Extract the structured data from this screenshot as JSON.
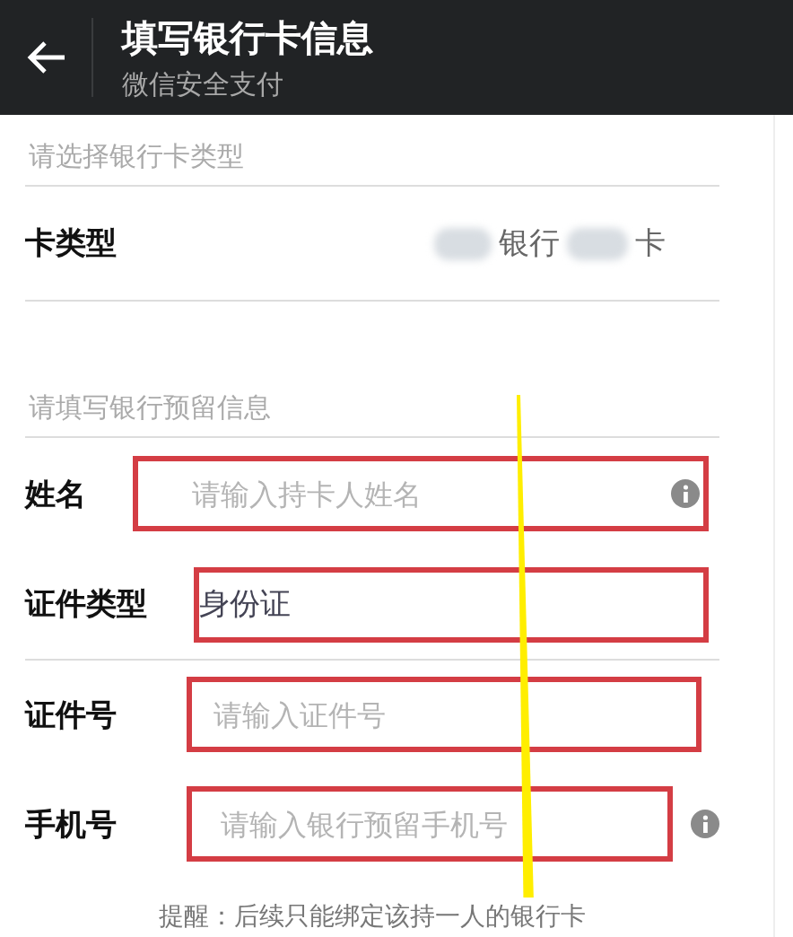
{
  "header": {
    "title": "填写银行卡信息",
    "subtitle": "微信安全支付"
  },
  "card_section": {
    "heading": "请选择银行卡类型",
    "label": "卡类型",
    "value_parts": [
      "银行",
      "卡"
    ]
  },
  "info_section": {
    "heading": "请填写银行预留信息",
    "rows": [
      {
        "label": "姓名",
        "placeholder": "请输入持卡人姓名",
        "info": true
      },
      {
        "label": "证件类型",
        "value": "身份证",
        "info": false
      },
      {
        "label": "证件号",
        "placeholder": "请输入证件号",
        "info": false
      },
      {
        "label": "手机号",
        "placeholder": "请输入银行预留手机号",
        "info": true
      }
    ]
  },
  "notice": "提醒：后续只能绑定该持一人的银行卡"
}
